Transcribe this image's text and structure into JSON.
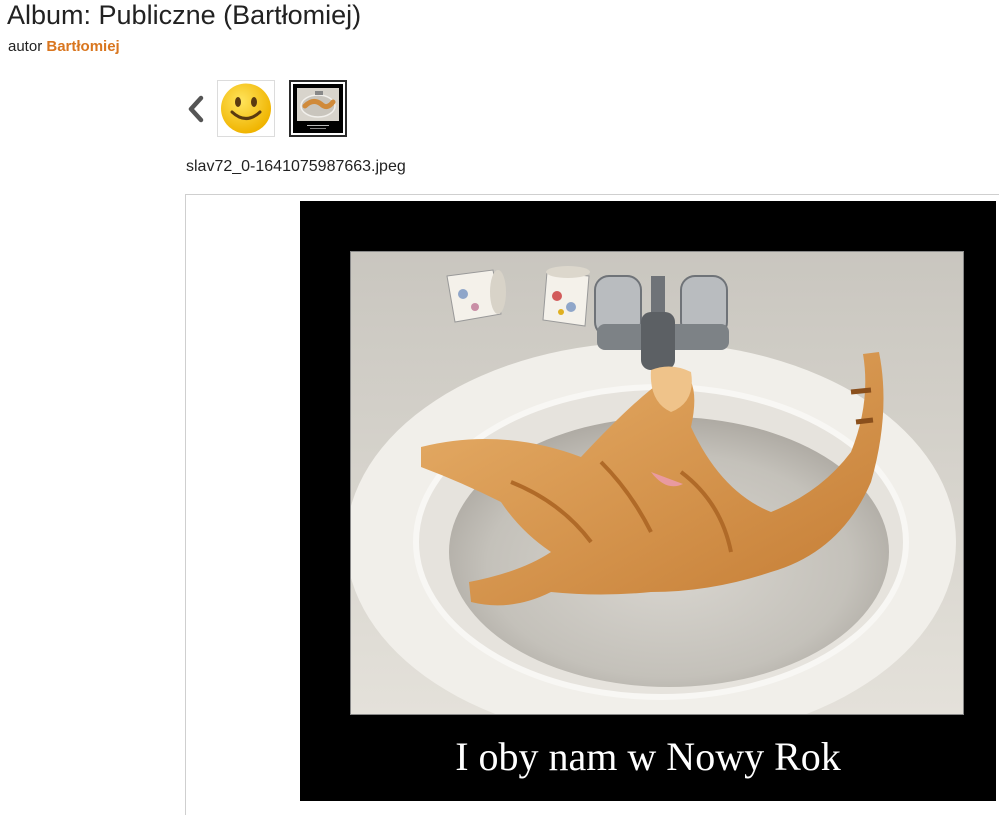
{
  "album": {
    "title": "Album: Publiczne (Bartłomiej)",
    "author_prefix": "autor",
    "author_name": "Bartłomiej"
  },
  "navigation": {
    "prev_icon": "chevron-left-icon",
    "thumbnails": [
      {
        "icon": "smiley-face-icon"
      },
      {
        "icon": "cat-photo-thumbnail",
        "active": true
      }
    ]
  },
  "photo": {
    "filename": "slav72_0-1641075987663.jpeg",
    "caption": "I oby nam w Nowy Rok"
  },
  "colors": {
    "author_link": "#d9761f",
    "photo_frame": "#000000",
    "smiley_fill": "#f5c518"
  }
}
